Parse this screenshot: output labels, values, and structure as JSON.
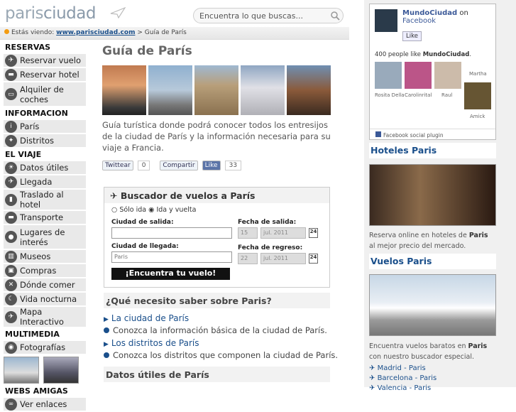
{
  "header": {
    "logo_part1": "paris",
    "logo_part2": "ciudad",
    "search_placeholder": "Encuentra lo que buscas..."
  },
  "breadcrumb": {
    "prefix": "Estás viendo:",
    "link": "www.parisciudad.com",
    "sep": ">",
    "current": "Guía de París"
  },
  "sidebar": {
    "section_reservas": "RESERVAS",
    "reservas": [
      "Reservar vuelo",
      "Reservar hotel",
      "Alquiler de coches"
    ],
    "section_info": "INFORMACION",
    "info": [
      "París",
      "Distritos"
    ],
    "section_viaje": "EL VIAJE",
    "viaje": [
      "Datos útiles",
      "Llegada",
      "Traslado al hotel",
      "Transporte",
      "Lugares de interés",
      "Museos",
      "Compras",
      "Dónde comer",
      "Vida nocturna",
      "Mapa Interactivo"
    ],
    "section_multimedia": "MULTIMEDIA",
    "multimedia": [
      "Fotografías"
    ],
    "section_webs": "WEBS AMIGAS",
    "webs": [
      "Ver enlaces"
    ]
  },
  "main": {
    "title": "Guía de París",
    "description": "Guía turística donde podrá conocer todos los entresijos de la ciudad de París y la información necesaria para su viaje a Francia.",
    "twitter_label": "Twittear",
    "twitter_count": "0",
    "share_label": "Compartir",
    "like_label": "Like",
    "like_count": "33"
  },
  "flights": {
    "title": "Buscador de vuelos a París",
    "radio_one": "Sólo ida",
    "radio_round": "Ida y vuelta",
    "origin_label": "Ciudad de salida:",
    "origin_value": "",
    "dest_label": "Ciudad de llegada:",
    "dest_value": "Paris",
    "depart_label": "Fecha de salida:",
    "depart_day": "15",
    "depart_month": "jul. 2011",
    "return_label": "Fecha de regreso:",
    "return_day": "22",
    "return_month": "jul. 2011",
    "cal_label": "24",
    "button": "¡Encuentra tu vuelo!"
  },
  "need": {
    "heading": "¿Qué necesito saber sobre Paris?",
    "link1": "La ciudad de París",
    "info1": "Conozca la información básica de la ciudad de París.",
    "link2": "Los distritos de París",
    "info2": "Conozca los distritos que componen la ciudad de París.",
    "datos_heading": "Datos útiles de París"
  },
  "right": {
    "fb_name": "MundoCiudad",
    "fb_on": "on",
    "fb_site": "Facebook",
    "fb_like": "Like",
    "fb_people_prefix": "400 people like ",
    "fb_people_name": "MundoCiudad",
    "fb_people_suffix": ".",
    "fb_faces": [
      "Rosita Della",
      "Carolinrital",
      "Raul",
      "Martha",
      "Amick"
    ],
    "fb_plugin": "Facebook social plugin",
    "hotels_heading": "Hoteles Paris",
    "hotels_text_1": "Reserva online en hoteles de ",
    "hotels_text_bold": "Paris",
    "hotels_text_2": " al mejor precio del mercado.",
    "flights_heading": "Vuelos Paris",
    "flights_text_1": "Encuentra vuelos baratos en ",
    "flights_text_bold": "Paris",
    "flights_text_2": " con nuestro buscador especial.",
    "routes": [
      "Madrid - Paris",
      "Barcelona - Paris",
      "Valencia - Paris"
    ]
  }
}
